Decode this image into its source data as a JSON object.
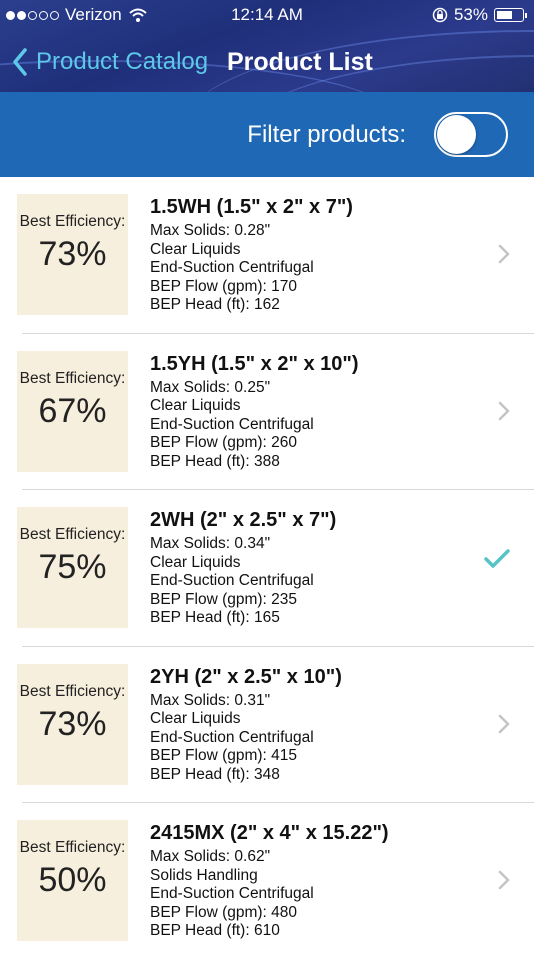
{
  "status": {
    "carrier": "Verizon",
    "time": "12:14 AM",
    "battery": "53%",
    "signal_bars": 2
  },
  "nav": {
    "back_label": "Product Catalog",
    "title": "Product List"
  },
  "filter": {
    "label": "Filter products:",
    "enabled": false
  },
  "colors": {
    "accent": "#5ec8e8",
    "filterbar": "#1f68b5",
    "card": "#f6efdd",
    "check": "#56c3c7"
  },
  "products": [
    {
      "eff_label": "Best Efficiency:",
      "efficiency": "73%",
      "name": "1.5WH (1.5\" x 2\" x 7\")",
      "max_solids": "Max Solids: 0.28\"",
      "liquid": "Clear Liquids",
      "pump_type": "End-Suction Centrifugal",
      "bep_flow": "BEP Flow (gpm): 170",
      "bep_head": "BEP Head (ft): 162",
      "accessory": "chevron"
    },
    {
      "eff_label": "Best Efficiency:",
      "efficiency": "67%",
      "name": "1.5YH (1.5\" x 2\" x 10\")",
      "max_solids": "Max Solids: 0.25\"",
      "liquid": "Clear Liquids",
      "pump_type": "End-Suction Centrifugal",
      "bep_flow": "BEP Flow (gpm): 260",
      "bep_head": "BEP Head (ft): 388",
      "accessory": "chevron"
    },
    {
      "eff_label": "Best Efficiency:",
      "efficiency": "75%",
      "name": "2WH (2\" x 2.5\" x 7\")",
      "max_solids": "Max Solids: 0.34\"",
      "liquid": "Clear Liquids",
      "pump_type": "End-Suction Centrifugal",
      "bep_flow": "BEP Flow (gpm): 235",
      "bep_head": "BEP Head (ft): 165",
      "accessory": "checkmark"
    },
    {
      "eff_label": "Best Efficiency:",
      "efficiency": "73%",
      "name": "2YH (2\" x 2.5\" x 10\")",
      "max_solids": "Max Solids: 0.31\"",
      "liquid": "Clear Liquids",
      "pump_type": "End-Suction Centrifugal",
      "bep_flow": "BEP Flow (gpm): 415",
      "bep_head": "BEP Head (ft): 348",
      "accessory": "chevron"
    },
    {
      "eff_label": "Best Efficiency:",
      "efficiency": "50%",
      "name": "2415MX (2\" x 4\" x 15.22\")",
      "max_solids": "Max Solids: 0.62\"",
      "liquid": "Solids Handling",
      "pump_type": "End-Suction Centrifugal",
      "bep_flow": "BEP Flow (gpm): 480",
      "bep_head": "BEP Head (ft): 610",
      "accessory": "chevron"
    }
  ]
}
